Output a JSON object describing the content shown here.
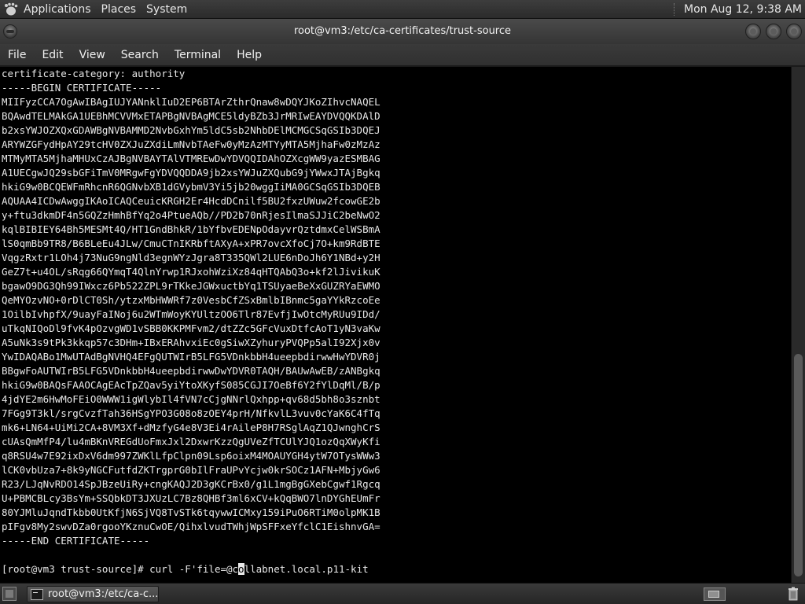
{
  "top_panel": {
    "menus": [
      "Applications",
      "Places",
      "System"
    ],
    "clock": "Mon Aug 12,  9:38 AM"
  },
  "window": {
    "title": "root@vm3:/etc/ca-certificates/trust-source"
  },
  "menu_bar": {
    "items": [
      "File",
      "Edit",
      "View",
      "Search",
      "Terminal",
      "Help"
    ]
  },
  "terminal": {
    "lines": [
      "certificate-category: authority",
      "-----BEGIN CERTIFICATE-----",
      "MIIFyzCCA7OgAwIBAgIUJYANnklIuD2EP6BTArZthrQnaw8wDQYJKoZIhvcNAQEL",
      "BQAwdTELMAkGA1UEBhMCVVMxETAPBgNVBAgMCE5ldyBZb3JrMRIwEAYDVQQKDAlD",
      "b2xsYWJOZXQxGDAWBgNVBAMMD2NvbGxhYm5ldC5sb2NhbDElMCMGCSqGSIb3DQEJ",
      "ARYWZGFydHpAY29tcHV0ZXJuZXdiLmNvbTAeFw0yMzAzMTYyMTA5MjhaFw0zMzAz",
      "MTMyMTA5MjhaMHUxCzAJBgNVBAYTAlVTMREwDwYDVQQIDAhOZXcgWW9yazESMBAG",
      "A1UECgwJQ29sbGFiTmV0MRgwFgYDVQQDDA9jb2xsYWJuZXQubG9jYWwxJTAjBgkq",
      "hkiG9w0BCQEWFmRhcnR6QGNvbXB1dGVybmV3Yi5jb20wggIiMA0GCSqGSIb3DQEB",
      "AQUAA4ICDwAwggIKAoICAQCeuicKRGH2Er4HcdDCnilf5BU2fxzUWuw2fcowGE2b",
      "y+ftu3dkmDF4n5GQZzHmhBfYq2o4PtueAQb//PD2b70nRjesIlmaSJJiC2beNwO2",
      "kqlBIBIEY64Bh5MESMt4Q/HT1GndBhkR/1bYfbvEDENpOdayvrQztdmxCelWSBmA",
      "lS0qmBb9TR8/B6BLeEu4JLw/CmuCTnIKRbftAXyA+xPR7ovcXfoCj7O+km9RdBTE",
      "VqgzRxtr1LOh4j73NuG9ngNld3egnWYzJgra8T335QWl2LUE6nDoJh6Y1NBd+y2H",
      "GeZ7t+u4OL/sRqg66QYmqT4QlnYrwp1RJxohWziXz84qHTQAbQ3o+kf2lJivikuK",
      "bgawO9DG3Qh99IWxcz6Pb522ZPL9rTKkeJGWxuctbYq1TSUyaeBeXxGUZRYaEWMO",
      "QeMYOzvNO+0rDlCT0Sh/ytzxMbHWWRf7z0VesbCfZSxBmlbIBnmc5gaYYkRzcoEe",
      "1OilbIvhpfX/9uayFaINoj6u2WTmWoyKYUltzOO6Tlr87EvfjIwOtcMyRUu9IDd/",
      "uTkqNIQoDl9fvK4pOzvgWD1vSBB0KKPMFvm2/dtZZc5GFcVuxDtfcAoT1yN3vaKw",
      "A5uNk3s9tPk3kkqp57c3DHm+IBxERAhvxiEc0gSiwXZyhuryPVQPp5alI92Xjx0v",
      "YwIDAQABo1MwUTAdBgNVHQ4EFgQUTWIrB5LFG5VDnkbbH4ueepbdirwwHwYDVR0j",
      "BBgwFoAUTWIrB5LFG5VDnkbbH4ueepbdirwwDwYDVR0TAQH/BAUwAwEB/zANBgkq",
      "hkiG9w0BAQsFAAOCAgEAcTpZQav5yiYtoXKyfS085CGJI7OeBf6Y2fYlDqMl/B/p",
      "4jdYE2m6HwMoFEiO0WWW1igWlybIl4fVN7cCjgNNrlQxhpp+qv68d5bh8o3sznbt",
      "7FGg9T3kl/srgCvzfTah36HSgYPO3G08o8zOEY4prH/NfkvlL3vuv0cYaK6C4fTq",
      "mk6+LN64+UiMi2CA+8VM3Xf+dMzfyG4e8V3Ei4rAileP8H7RSglAqZ1QJwnghCrS",
      "cUAsQmMfP4/lu4mBKnVREGdUoFmxJxl2DxwrKzzQgUVeZfTCUlYJQ1ozQqXWyKfi",
      "q8RSU4w7E92ixDxV6dm997ZWKlLfpClpn09Lsp6oixM4MOAUYGH4ytW7OTysWWw3",
      "lCK0vbUza7+8k9yNGCFutfdZKTrgprG0bIlFraUPvYcjw0krSOCz1AFN+MbjyGw6",
      "R23/LJqNvRDO14SpJBzeUiRy+cngKAQJ2D3gKCrBx0/g1L1mgBgGXebCgwf1Rgcq",
      "U+PBMCBLcy3BsYm+SSQbkDT3JXUzLC7Bz8QHBf3ml6xCV+kQqBWO7lnDYGhEUmFr",
      "80YJMluJqndTkbb0UtKfjN6SjVQ8TvSTk6tqywwICMxy159iPuO6RTiM0olpMK1B",
      "pIFgv8My2swvDZa0rgooYKznuCwOE/QihxlvudTWhjWpSFFxeYfclC1EishnvGA=",
      "-----END CERTIFICATE-----"
    ],
    "prompt": "[root@vm3 trust-source]# ",
    "command_before_cursor": "curl -F'file=@c",
    "cursor_char": "o",
    "command_after_cursor": "llabnet.local.p11-kit"
  },
  "taskbar": {
    "task_label": "root@vm3:/etc/ca-c..."
  },
  "colors": {
    "terminal_bg": "#000000",
    "terminal_fg": "#e8e8e8",
    "panel_bg": "#333333"
  }
}
